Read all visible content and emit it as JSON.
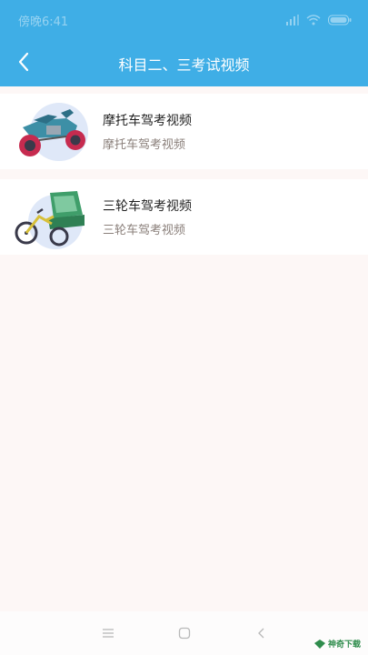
{
  "status_bar": {
    "time": "傍晚6:41"
  },
  "header": {
    "title": "科目二、三考试视频"
  },
  "videos": [
    {
      "title": "摩托车驾考视频",
      "subtitle": "摩托车驾考视频",
      "icon": "motorcycle-icon"
    },
    {
      "title": "三轮车驾考视频",
      "subtitle": "三轮车驾考视频",
      "icon": "tricycle-icon"
    }
  ],
  "watermark": {
    "text": "神奇下载"
  },
  "colors": {
    "header": "#3faee6",
    "background": "#fdf7f6",
    "card": "#ffffff"
  }
}
